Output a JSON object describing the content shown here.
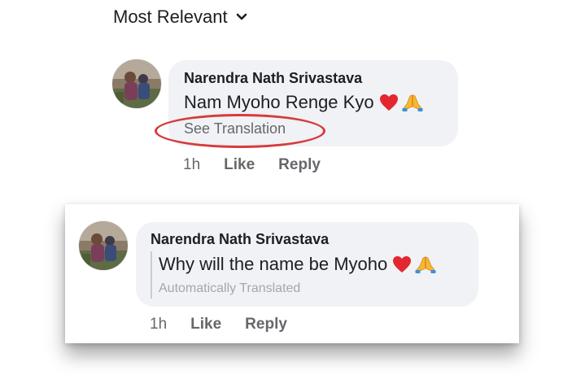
{
  "sort": {
    "label": "Most Relevant"
  },
  "comments": [
    {
      "author": "Narendra Nath Srivastava",
      "text": "Nam Myoho Renge Kyo",
      "see_translation": "See Translation",
      "time": "1h",
      "like": "Like",
      "reply": "Reply",
      "emojis": [
        "red-heart",
        "folded-hands"
      ]
    },
    {
      "author": "Narendra Nath Srivastava",
      "text": "Why will the name be Myoho",
      "auto_translated": "Automatically Translated",
      "time": "1h",
      "like": "Like",
      "reply": "Reply",
      "emojis": [
        "red-heart",
        "folded-hands"
      ]
    }
  ],
  "colors": {
    "bubble": "#f0f2f5",
    "secondary_text": "#65676b",
    "highlight_oval": "#d63b3b",
    "heart": "#e3262f",
    "hands": "#f7b733"
  }
}
